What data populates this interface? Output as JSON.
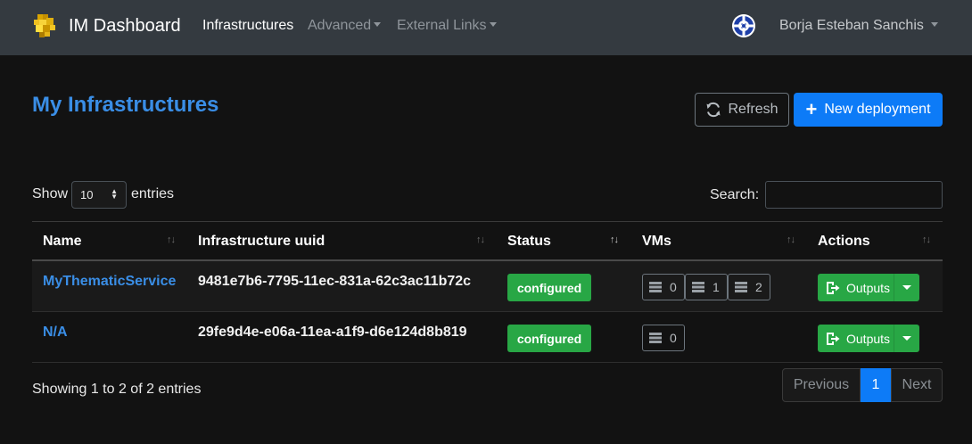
{
  "navbar": {
    "brand": "IM Dashboard",
    "items": [
      {
        "label": "Infrastructures",
        "active": true,
        "dropdown": false
      },
      {
        "label": "Advanced",
        "active": false,
        "dropdown": true
      },
      {
        "label": "External Links",
        "active": false,
        "dropdown": true
      }
    ],
    "user": "Borja Esteban Sanchis"
  },
  "page": {
    "title": "My Infrastructures",
    "refresh_label": "Refresh",
    "new_deployment_label": "New deployment"
  },
  "table_controls": {
    "show_label": "Show",
    "page_length": "10",
    "entries_label": "entries",
    "search_label": "Search:",
    "search_value": ""
  },
  "table": {
    "columns": [
      "Name",
      "Infrastructure uuid",
      "Status",
      "VMs",
      "Actions"
    ],
    "rows": [
      {
        "name": "MyThematicService",
        "uuid": "9481e7b6-7795-11ec-831a-62c3ac11b72c",
        "status": "configured",
        "vms": [
          "0",
          "1",
          "2"
        ],
        "action": "Outputs"
      },
      {
        "name": "N/A",
        "uuid": "29fe9d4e-e06a-11ea-a1f9-d6e124d8b819",
        "status": "configured",
        "vms": [
          "0"
        ],
        "action": "Outputs"
      }
    ]
  },
  "footer": {
    "info": "Showing 1 to 2 of 2 entries",
    "previous": "Previous",
    "current_page": "1",
    "next": "Next"
  },
  "colors": {
    "accent": "#0d7bf7",
    "link": "#3a8ee6",
    "success": "#28a745",
    "navbar": "#343a40",
    "background": "#121212"
  }
}
